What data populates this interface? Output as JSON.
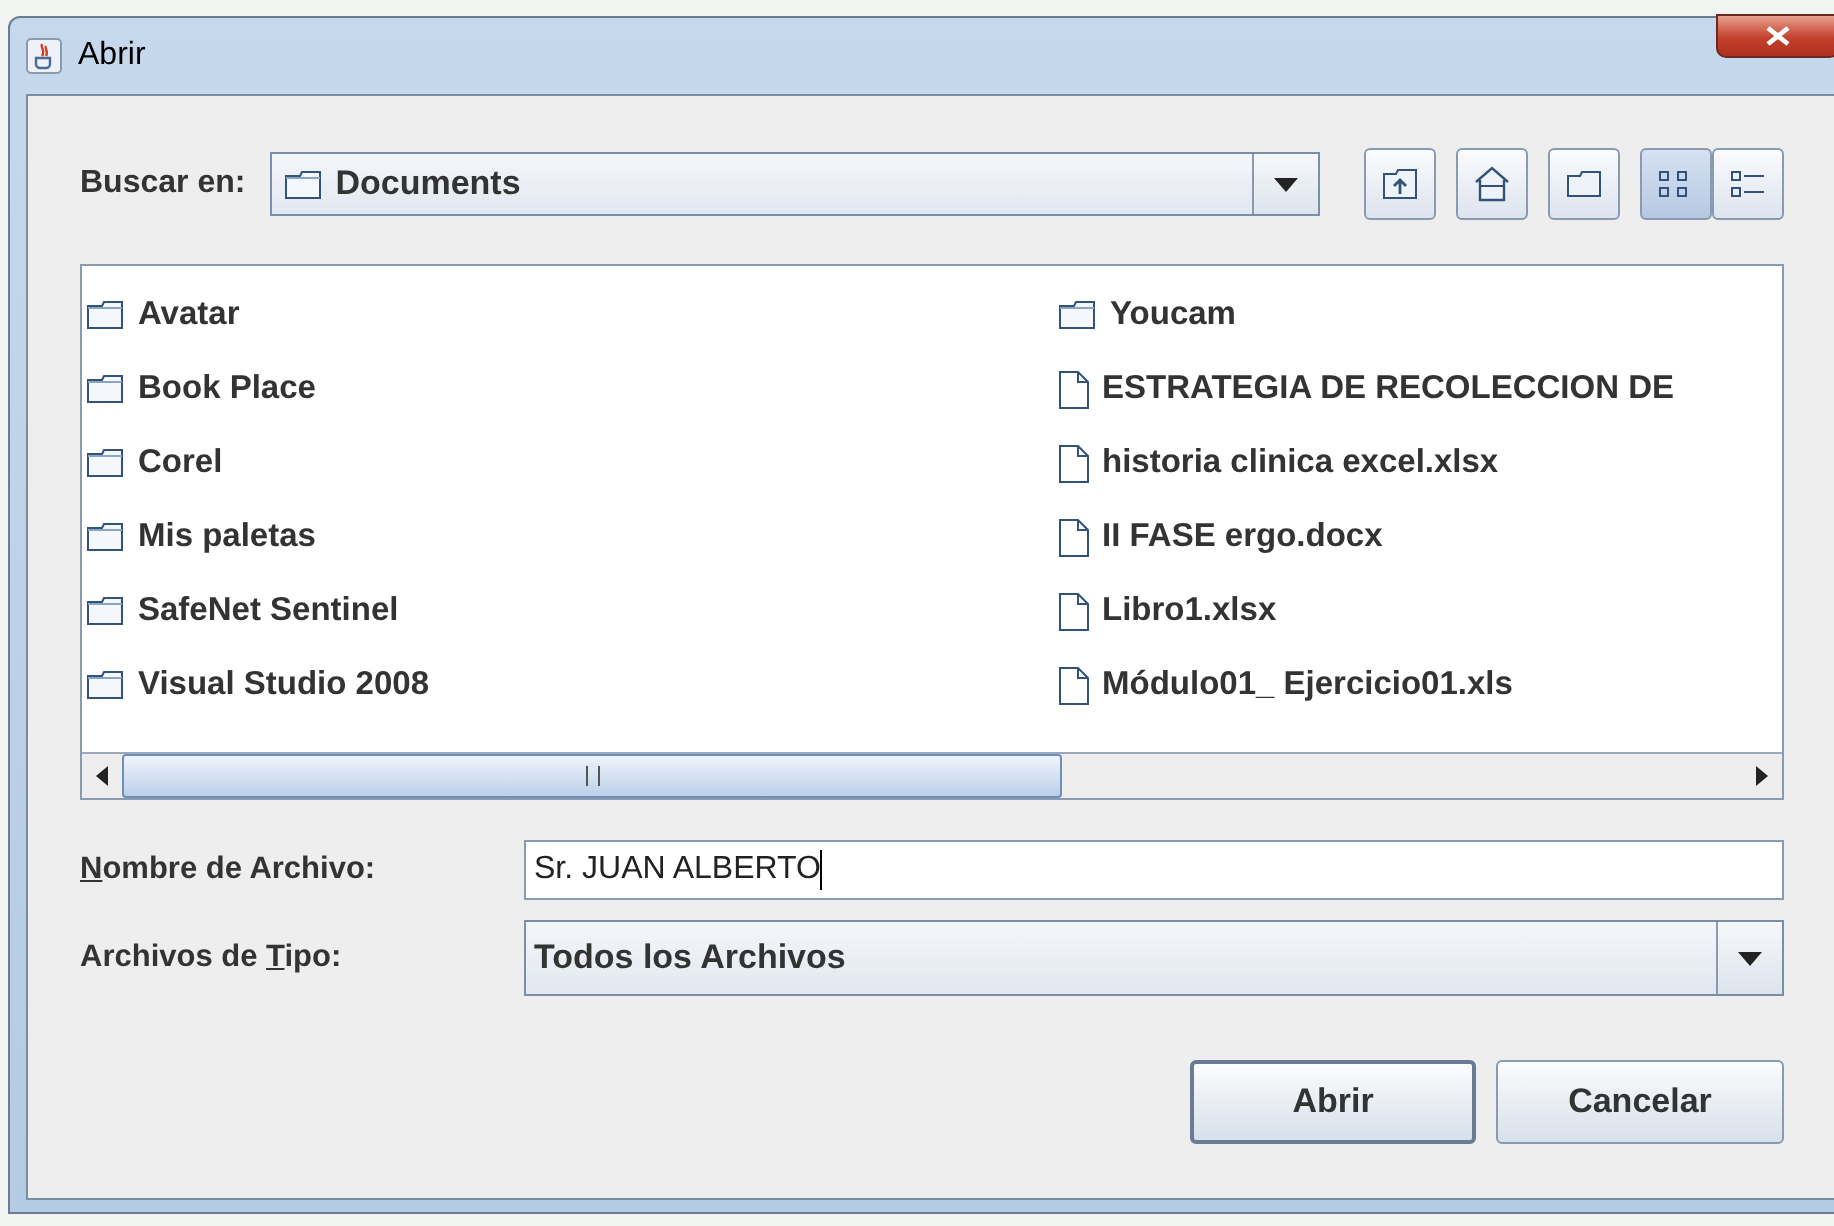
{
  "window": {
    "title": "Abrir"
  },
  "look_in": {
    "label": "Buscar en:",
    "value": "Documents"
  },
  "toolbar": [
    {
      "kind": "up",
      "selected": false
    },
    {
      "kind": "home",
      "selected": false
    },
    {
      "kind": "new-folder",
      "selected": false
    },
    {
      "kind": "list",
      "selected": true
    },
    {
      "kind": "details",
      "selected": false
    }
  ],
  "files": {
    "columns": [
      [
        {
          "name": "Avatar",
          "kind": "folder"
        },
        {
          "name": "Book Place",
          "kind": "folder"
        },
        {
          "name": "Corel",
          "kind": "folder"
        },
        {
          "name": "Mis paletas",
          "kind": "folder"
        },
        {
          "name": "SafeNet Sentinel",
          "kind": "folder"
        },
        {
          "name": "Visual Studio 2008",
          "kind": "folder"
        }
      ],
      [
        {
          "name": "Youcam",
          "kind": "folder"
        },
        {
          "name": "ESTRATEGIA DE RECOLECCION DE",
          "kind": "file"
        },
        {
          "name": "historia clinica excel.xlsx",
          "kind": "file"
        },
        {
          "name": "II FASE ergo.docx",
          "kind": "file"
        },
        {
          "name": "Libro1.xlsx",
          "kind": "file"
        },
        {
          "name": "Módulo01_ Ejercicio01.xls",
          "kind": "file"
        }
      ]
    ]
  },
  "file_name": {
    "label": "Nombre de Archivo:",
    "value": "Sr. JUAN ALBERTO"
  },
  "file_type": {
    "label": "Archivos de Tipo:",
    "value": "Todos los Archivos"
  },
  "buttons": [
    {
      "label": "Abrir",
      "default": true
    },
    {
      "label": "Cancelar",
      "default": false
    }
  ]
}
